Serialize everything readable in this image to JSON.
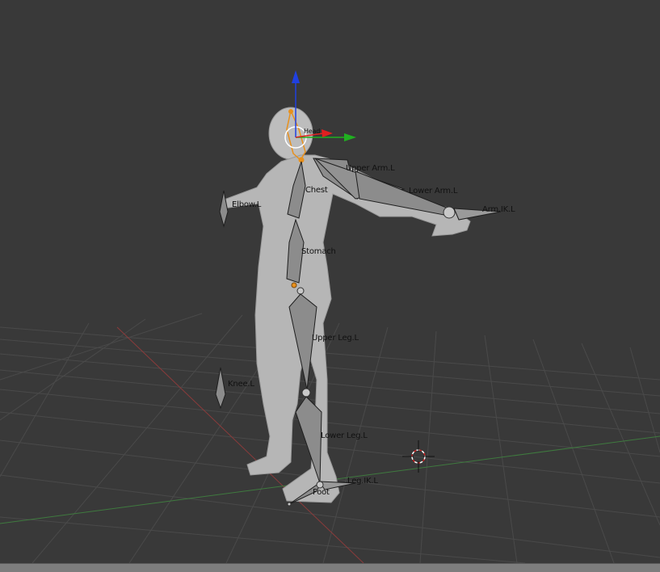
{
  "viewport": {
    "background": "#393939",
    "grid_color": "#4a4a4a",
    "x_axis_color": "#8a3b3b",
    "y_axis_color": "#3f7a3f"
  },
  "bones": [
    {
      "id": "head",
      "label": "Head"
    },
    {
      "id": "upper-arm-l",
      "label": "Upper Arm.L"
    },
    {
      "id": "lower-arm-l",
      "label": "Lower Arm.L"
    },
    {
      "id": "arm-ik-l",
      "label": "Arm.IK.L"
    },
    {
      "id": "chest",
      "label": "Chest"
    },
    {
      "id": "elbow-l",
      "label": "Elbow.L"
    },
    {
      "id": "stomach",
      "label": "Stomach"
    },
    {
      "id": "upper-leg-l",
      "label": "Upper Leg.L"
    },
    {
      "id": "knee-l",
      "label": "Knee.L"
    },
    {
      "id": "lower-leg-l",
      "label": "Lower Leg.L"
    },
    {
      "id": "leg-ik-l",
      "label": "Leg.IK.L"
    },
    {
      "id": "foot",
      "label": "Foot"
    }
  ],
  "gizmo": {
    "x_color": "#e02020",
    "y_color": "#20b020",
    "z_color": "#2040e0"
  },
  "selection_color": "#e8901c"
}
